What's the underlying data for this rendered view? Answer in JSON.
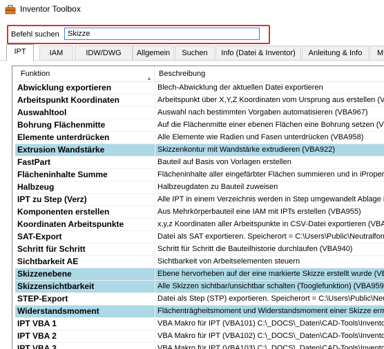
{
  "window": {
    "title": "Inventor Toolbox",
    "icon": "toolbox-icon"
  },
  "search": {
    "label": "Befehl suchen",
    "value": "Skizze"
  },
  "tabs": [
    {
      "label": "IPT",
      "active": true
    },
    {
      "label": "IAM"
    },
    {
      "label": "IDW/DWG"
    },
    {
      "label": "Allgemein"
    },
    {
      "label": "Suchen"
    },
    {
      "label": "Info (Datei & Inventor)"
    },
    {
      "label": "Anleitung & Info"
    },
    {
      "label": "M"
    }
  ],
  "table": {
    "columns": [
      "Funktion",
      "Beschreibung"
    ],
    "sort_icon": "sort-up-icon",
    "highlight_color": "#add8e6",
    "rows": [
      {
        "name": "Abwicklung exportieren",
        "desc": "Blech-Abwicklung der aktuellen Datei exportieren"
      },
      {
        "name": "Arbeitspunkt Koordinaten",
        "desc": "Arbeitspunkt über X,Y,Z Koordinaten vom Ursprung aus erstellen (VBA"
      },
      {
        "name": "Auswahltool",
        "desc": "Auswahl nach bestimmten Vorgaben automatisieren (VBA967)"
      },
      {
        "name": "Bohrung Flächenmitte",
        "desc": "Auf die Flächenmitte einer ebenen Flächen eine Bohrung setzen (VBA"
      },
      {
        "name": "Elemente unterdrücken",
        "desc": "Alle Elemente wie Radien und Fasen unterdrücken (VBA958)"
      },
      {
        "name": "Extrusion Wandstärke",
        "desc": "Skizzenkontur mit Wandstärke extrudieren (VBA922)",
        "highlight": true
      },
      {
        "name": "FastPart",
        "desc": "Bauteil auf Basis von Vorlagen erstellen"
      },
      {
        "name": "Flächeninhalte Summe",
        "desc": "Flächeninhalte aller eingefärbter Flächen summieren und in iProperty se"
      },
      {
        "name": "Halbzeug",
        "desc": "Halbzeugdaten zu Bauteil zuweisen"
      },
      {
        "name": "IPT zu Step (Verz)",
        "desc": "Alle IPT in einem Verzeichnis werden in Step umgewandelt Ablage in ("
      },
      {
        "name": "Komponenten erstellen",
        "desc": "Aus Mehrkörperbauteil eine IAM mit IPTs erstellen (VBA955)"
      },
      {
        "name": "Koordinaten Arbeitspunkte",
        "desc": "x,y,z Koordinaten aller Arbeitspunkte in CSV-Datei exportieren (VBA94"
      },
      {
        "name": "SAT-Export",
        "desc": "Datei als SAT exportieren. Speicherort = C:\\Users\\Public\\Neutralforma"
      },
      {
        "name": "Schritt für Schritt",
        "desc": "Schritt für Schritt die Bauteilhistorie durchlaufen (VBA940)"
      },
      {
        "name": "Sichtbarkeit AE",
        "desc": "Sichtbarkeit von Arbeitselementen steuern"
      },
      {
        "name": "Skizzenebene",
        "desc": "Ebene hervorheben auf der eine markierte Skizze erstellt wurde (VBAS",
        "highlight": true
      },
      {
        "name": "Skizzensichtbarkeit",
        "desc": "Alle Skizzen sichtbar/unsichtbar schalten (Tooglefunktion) (VBA959)",
        "highlight": true
      },
      {
        "name": "STEP-Export",
        "desc": "Datei als Step (STP) exportieren. Speicherort = C:\\Users\\Public\\Neutr"
      },
      {
        "name": "Widerstandsmoment",
        "desc": "Flächenträgheitsmoment und Widerstandsmoment einer Skizze ermitte",
        "highlight": true
      },
      {
        "name": "IPT VBA 1",
        "desc": "VBA Makro für IPT (VBA101) C:\\_DOCS\\_Daten\\CAD-Tools\\Inventor"
      },
      {
        "name": "IPT VBA 2",
        "desc": "VBA Makro für IPT (VBA102) C:\\_DOCS\\_Daten\\CAD-Tools\\Inventor"
      },
      {
        "name": "IPT VBA 3",
        "desc": "VBA Makro für IPT (VBA103) C:\\_DOCS\\_Daten\\CAD-Tools\\Inventor"
      }
    ]
  }
}
